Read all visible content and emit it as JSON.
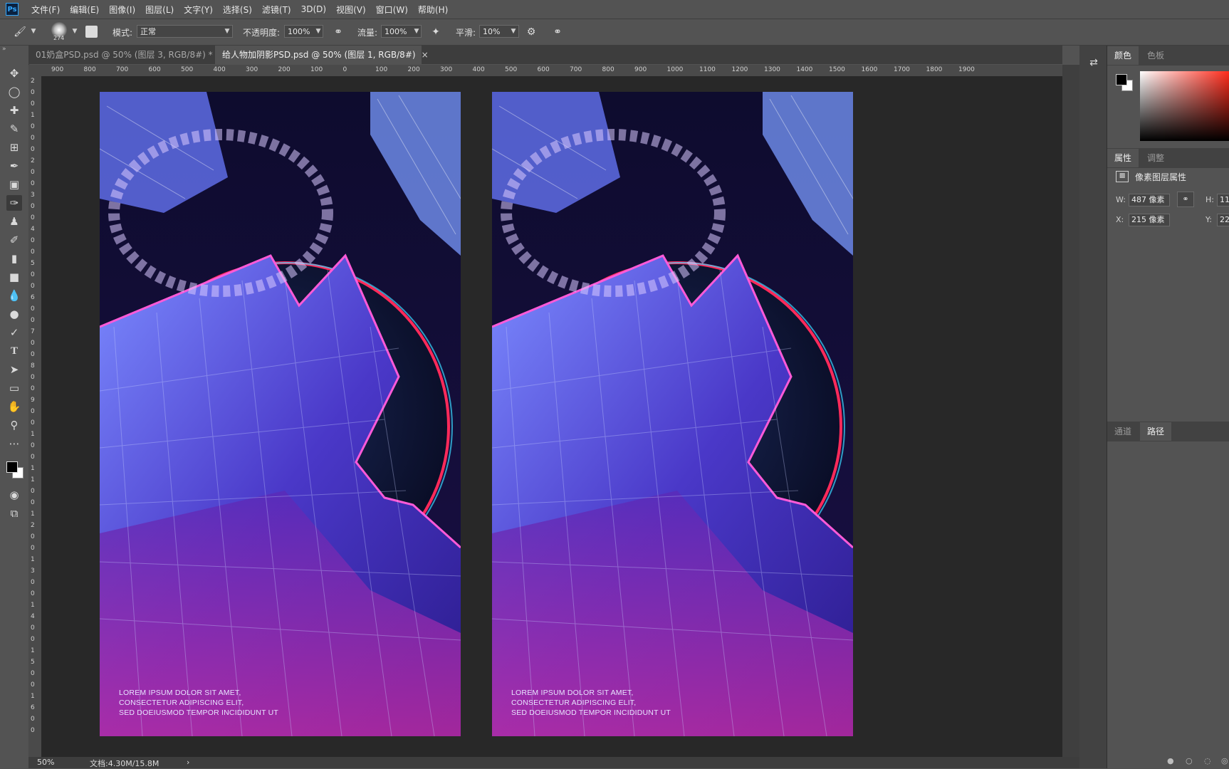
{
  "app": {
    "logo": "Ps"
  },
  "menu": [
    "文件(F)",
    "编辑(E)",
    "图像(I)",
    "图层(L)",
    "文字(Y)",
    "选择(S)",
    "滤镜(T)",
    "3D(D)",
    "视图(V)",
    "窗口(W)",
    "帮助(H)"
  ],
  "options": {
    "brush_size": "274",
    "mode_label": "模式:",
    "mode_value": "正常",
    "opacity_label": "不透明度:",
    "opacity_value": "100%",
    "flow_label": "流量:",
    "flow_value": "100%",
    "smoothing_label": "平滑:",
    "smoothing_value": "10%"
  },
  "tabs": [
    {
      "label": "01奶盒PSD.psd @ 50% (图层 3, RGB/8#) *",
      "active": false
    },
    {
      "label": "给人物加阴影PSD.psd @ 50% (图层 1, RGB/8#)",
      "active": true
    }
  ],
  "ruler": {
    "h_ticks": [
      "900",
      "800",
      "700",
      "600",
      "500",
      "400",
      "300",
      "200",
      "100",
      "0",
      "100",
      "200",
      "300",
      "400",
      "500",
      "600",
      "700",
      "800",
      "900",
      "1000",
      "1100",
      "1200",
      "1300",
      "1400",
      "1500",
      "1600",
      "1700",
      "1800",
      "1900"
    ],
    "v_ticks": [
      "2",
      "0",
      "0",
      "1",
      "0",
      "0",
      "0",
      "2",
      "0",
      "0",
      "3",
      "0",
      "0",
      "4",
      "0",
      "0",
      "5",
      "0",
      "0",
      "6",
      "0",
      "0",
      "7",
      "0",
      "0",
      "8",
      "0",
      "0",
      "9",
      "0",
      "0",
      "1",
      "0",
      "0",
      "1",
      "1",
      "0",
      "0",
      "1",
      "2",
      "0",
      "0",
      "1",
      "3",
      "0",
      "0",
      "1",
      "4",
      "0",
      "0",
      "1",
      "5",
      "0",
      "0",
      "1",
      "6",
      "0",
      "0"
    ]
  },
  "poster": {
    "lines": [
      "LOREM IPSUM DOLOR SIT AMET,",
      "CONSECTETUR ADIPISCING ELIT,",
      "SED DOEIUSMOD TEMPOR INCIDIDUNT UT"
    ],
    "ring_text": "TEMPOR INCIDIDUNT UT LABORE DOLOR SIT AMET"
  },
  "status": {
    "zoom": "50%",
    "doc": "文档:4.30M/15.8M"
  },
  "panels": {
    "color_tabs": [
      "颜色",
      "色板"
    ],
    "prop_tabs": [
      "属性",
      "调整"
    ],
    "prop_title": "像素图层属性",
    "w_label": "W:",
    "w_value": "487 像素",
    "h_label": "H:",
    "h_value": "11",
    "x_label": "X:",
    "x_value": "215 像素",
    "y_label": "Y:",
    "y_value": "22",
    "path_tabs": [
      "通道",
      "路径"
    ]
  }
}
